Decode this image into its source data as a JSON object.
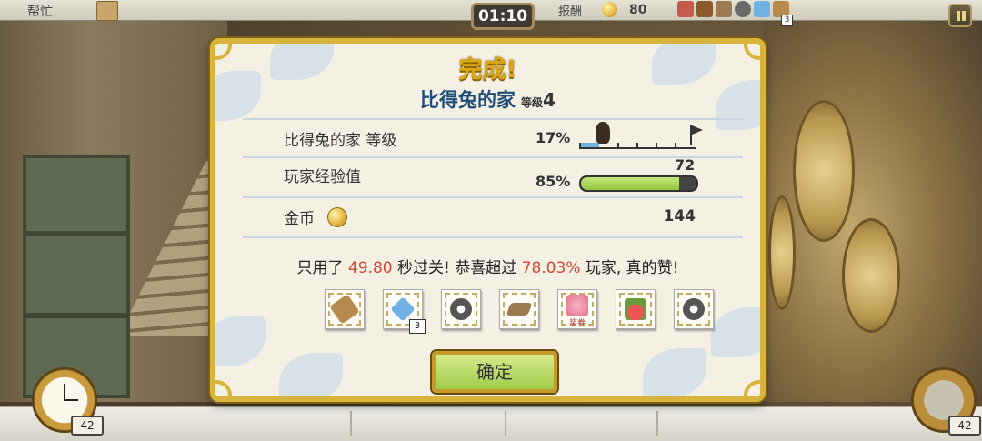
{
  "hud": {
    "help_label": "帮忙",
    "timer": "01:10",
    "reward_label": "报酬",
    "reward_coins": "80",
    "item_badge": "3",
    "left_count": "42",
    "right_count": "42"
  },
  "dialog": {
    "title": "完成!",
    "location": "比得兔的家",
    "level_word": "等级",
    "level_num": "4",
    "rows": {
      "home_level_label": "比得兔的家 等级",
      "home_level_pct": "17%",
      "xp_label": "玩家经验值",
      "xp_pct": "85%",
      "xp_value": "72",
      "coins_label": "金币",
      "coins_value": "144"
    },
    "home_level_progress": 0.17,
    "xp_progress": 0.85,
    "sentence": {
      "part1": "只用了 ",
      "time": "49.80",
      "part2": " 秒过关! 恭喜超过 ",
      "percent": "78.03%",
      "part3": " 玩家, 真的赞!"
    },
    "rewards": [
      {
        "icon": "wood-log-icon"
      },
      {
        "icon": "blue-crystal-icon",
        "badge": "3"
      },
      {
        "icon": "gear-icon"
      },
      {
        "icon": "wood-plank-icon"
      },
      {
        "icon": "flower-voucher-icon",
        "label": "奖券"
      },
      {
        "icon": "radish-icon"
      },
      {
        "icon": "gear-icon"
      }
    ],
    "ok_button": "确定"
  },
  "colors": {
    "title_gold": "#d9a812",
    "location_blue": "#1f4d7a",
    "highlight_red": "#d84632",
    "button_green": "#9fcb4a",
    "frame_gold": "#d9b43c"
  }
}
